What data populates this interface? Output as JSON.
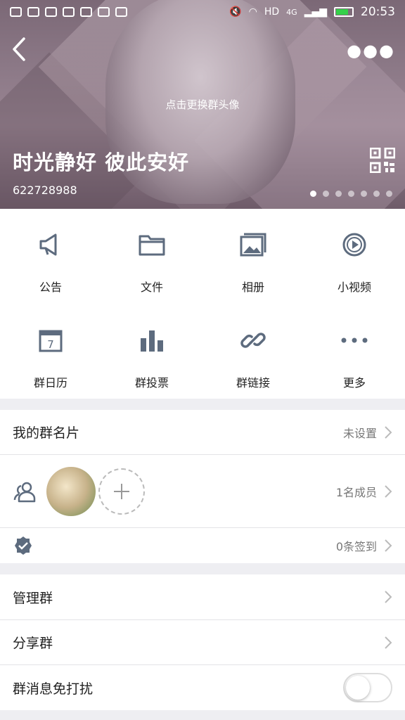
{
  "status_bar": {
    "time": "20:53",
    "network": "4G",
    "hd": "HD"
  },
  "header": {
    "change_avatar_hint": "点击更换群头像",
    "group_name": "时光静好 彼此安好",
    "group_id": "622728988",
    "page_dots": 7
  },
  "features": [
    {
      "label": "公告",
      "icon": "megaphone-icon"
    },
    {
      "label": "文件",
      "icon": "folder-icon"
    },
    {
      "label": "相册",
      "icon": "album-icon"
    },
    {
      "label": "小视频",
      "icon": "video-play-icon"
    },
    {
      "label": "群日历",
      "icon": "calendar-icon",
      "calendar_day": "7"
    },
    {
      "label": "群投票",
      "icon": "bar-chart-icon"
    },
    {
      "label": "群链接",
      "icon": "link-icon"
    },
    {
      "label": "更多",
      "icon": "more-dots-icon"
    }
  ],
  "my_card": {
    "title": "我的群名片",
    "value": "未设置"
  },
  "members": {
    "value": "1名成员"
  },
  "signin": {
    "value": "0条签到"
  },
  "manage": {
    "title": "管理群"
  },
  "share": {
    "title": "分享群"
  },
  "mute": {
    "title": "群消息免打扰",
    "enabled": false
  }
}
